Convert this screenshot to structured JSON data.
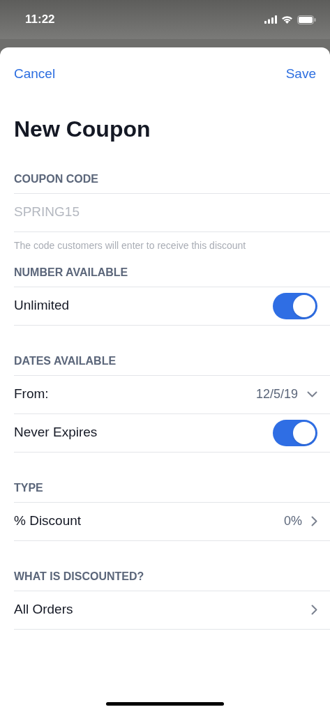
{
  "status_bar": {
    "time": "11:22"
  },
  "nav": {
    "cancel": "Cancel",
    "save": "Save"
  },
  "title": "New Coupon",
  "sections": [
    {
      "header": "COUPON CODE",
      "rows": [
        {
          "kind": "field",
          "placeholder": "SPRING15",
          "hint": "The code customers will enter to receive this discount"
        }
      ]
    },
    {
      "header": "NUMBER AVAILABLE",
      "rows": [
        {
          "kind": "toggle",
          "label": "Unlimited",
          "on": true
        }
      ]
    },
    {
      "header": "DATES AVAILABLE",
      "rows": [
        {
          "kind": "picker",
          "label": "From:",
          "value": "12/5/19"
        },
        {
          "kind": "toggle",
          "label": "Never Expires",
          "on": true
        }
      ]
    },
    {
      "header": "TYPE",
      "rows": [
        {
          "kind": "link",
          "label": "% Discount",
          "value": "0%"
        }
      ]
    },
    {
      "header": "WHAT IS DISCOUNTED?",
      "rows": [
        {
          "kind": "link",
          "label": "All Orders"
        }
      ]
    }
  ]
}
